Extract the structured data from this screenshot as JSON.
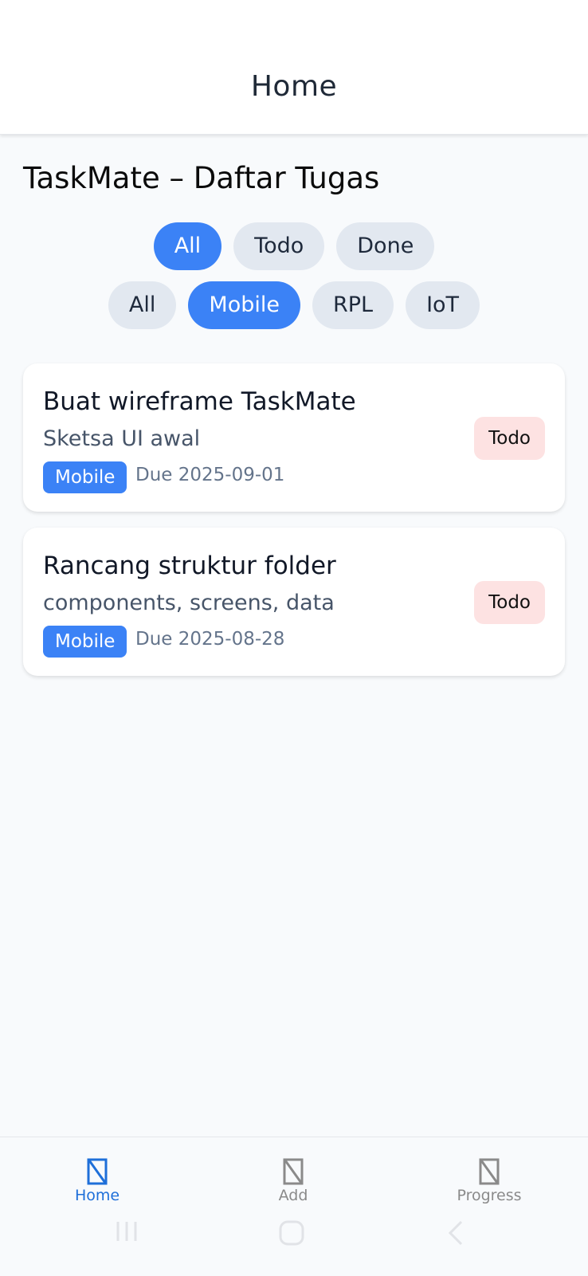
{
  "header": {
    "title": "Home"
  },
  "page": {
    "heading": "TaskMate – Daftar Tugas"
  },
  "status_filters": [
    {
      "label": "All",
      "active": true
    },
    {
      "label": "Todo",
      "active": false
    },
    {
      "label": "Done",
      "active": false
    }
  ],
  "category_filters": [
    {
      "label": "All",
      "active": false
    },
    {
      "label": "Mobile",
      "active": true
    },
    {
      "label": "RPL",
      "active": false
    },
    {
      "label": "IoT",
      "active": false
    }
  ],
  "tasks": [
    {
      "title": "Buat wireframe TaskMate",
      "description": "Sketsa UI awal",
      "category": "Mobile",
      "due": "Due 2025-09-01",
      "status": "Todo"
    },
    {
      "title": "Rancang struktur folder",
      "description": "components, screens, data",
      "category": "Mobile",
      "due": "Due 2025-08-28",
      "status": "Todo"
    }
  ],
  "bottom_nav": [
    {
      "label": "Home",
      "icon": "missing-glyph-icon",
      "active": true
    },
    {
      "label": "Add",
      "icon": "missing-glyph-icon",
      "active": false
    },
    {
      "label": "Progress",
      "icon": "missing-glyph-icon",
      "active": false
    }
  ],
  "colors": {
    "accent": "#3b82f6",
    "chip_inactive": "#e2e8f0",
    "status_todo_bg": "#fde2e2",
    "nav_active": "#1e6fd9"
  },
  "system_nav": {
    "icons": [
      "recent-apps-icon",
      "home-system-icon",
      "back-icon"
    ]
  }
}
